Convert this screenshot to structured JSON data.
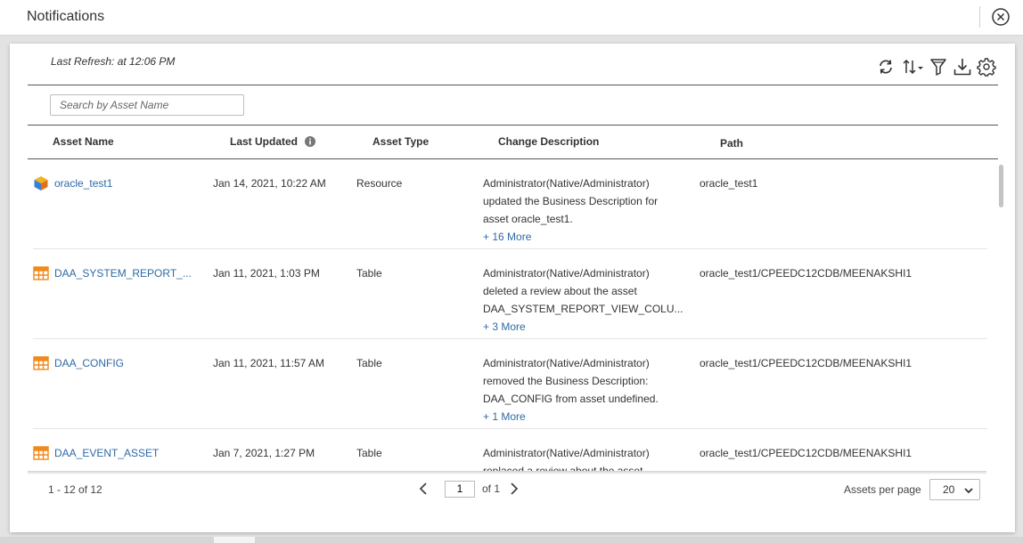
{
  "header": {
    "title": "Notifications",
    "close_icon": "close-circle-icon"
  },
  "toolbar": {
    "last_refresh": "Last Refresh: at 12:06 PM",
    "icons": [
      "refresh-icon",
      "sort-icon",
      "filter-icon",
      "download-icon",
      "settings-icon"
    ]
  },
  "search": {
    "placeholder": "Search by Asset Name",
    "value": ""
  },
  "columns": {
    "asset_name": "Asset Name",
    "last_updated": "Last Updated",
    "asset_type": "Asset Type",
    "change_description": "Change Description",
    "path": "Path"
  },
  "rows": [
    {
      "icon": "resource-cube-icon",
      "name": "oracle_test1",
      "updated": "Jan 14, 2021, 10:22 AM",
      "type": "Resource",
      "desc": [
        "Administrator(Native/Administrator)",
        "updated the Business Description for",
        "asset oracle_test1."
      ],
      "more": "+ 16 More",
      "path": "oracle_test1"
    },
    {
      "icon": "table-icon",
      "name": "DAA_SYSTEM_REPORT_...",
      "updated": "Jan 11, 2021, 1:03 PM",
      "type": "Table",
      "desc": [
        "Administrator(Native/Administrator)",
        "deleted a review about the asset",
        "DAA_SYSTEM_REPORT_VIEW_COLU..."
      ],
      "more": "+ 3 More",
      "path": "oracle_test1/CPEEDC12CDB/MEENAKSHI1"
    },
    {
      "icon": "table-icon",
      "name": "DAA_CONFIG",
      "updated": "Jan 11, 2021, 11:57 AM",
      "type": "Table",
      "desc": [
        "Administrator(Native/Administrator)",
        "removed the Business Description:",
        "DAA_CONFIG from asset undefined."
      ],
      "more": "+ 1 More",
      "path": "oracle_test1/CPEEDC12CDB/MEENAKSHI1"
    },
    {
      "icon": "table-icon",
      "name": "DAA_EVENT_ASSET",
      "updated": "Jan 7, 2021, 1:27 PM",
      "type": "Table",
      "desc": [
        "Administrator(Native/Administrator)",
        "replaced a review about the asset"
      ],
      "more": "",
      "path": "oracle_test1/CPEEDC12CDB/MEENAKSHI1"
    }
  ],
  "footer": {
    "range": "1 - 12 of 12",
    "page": "1",
    "of_pages": "of 1",
    "per_page_label": "Assets per page",
    "per_page_value": "20"
  },
  "colors": {
    "link": "#2e6aa5",
    "table_icon": "#f08a1c",
    "resource_icon": "#f2b322"
  }
}
